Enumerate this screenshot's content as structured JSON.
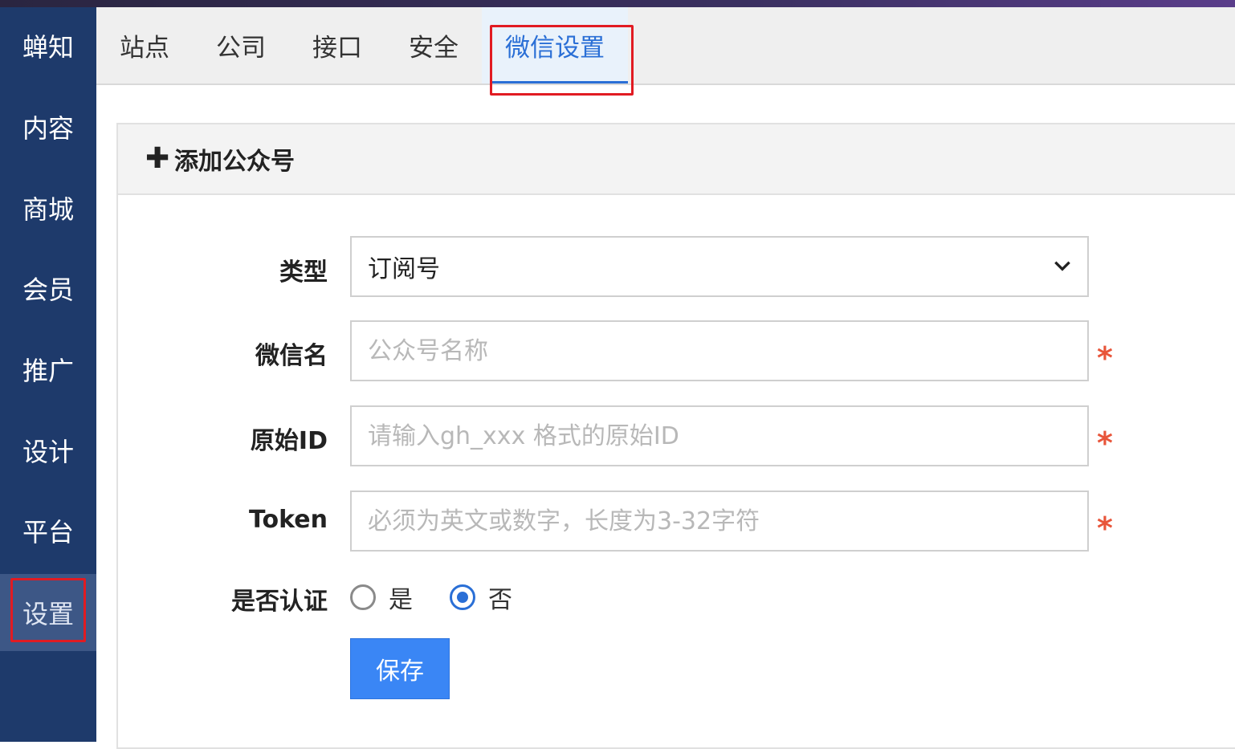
{
  "sidebar": {
    "items": [
      {
        "label": "蝉知"
      },
      {
        "label": "内容"
      },
      {
        "label": "商城"
      },
      {
        "label": "会员"
      },
      {
        "label": "推广"
      },
      {
        "label": "设计"
      },
      {
        "label": "平台"
      },
      {
        "label": "设置"
      }
    ],
    "active": "设置"
  },
  "tabs": [
    {
      "label": "站点"
    },
    {
      "label": "公司"
    },
    {
      "label": "接口"
    },
    {
      "label": "安全"
    },
    {
      "label": "微信设置"
    }
  ],
  "active_tab": "微信设置",
  "panel": {
    "title": "添加公众号"
  },
  "form": {
    "type_label": "类型",
    "type_value": "订阅号",
    "name_label": "微信名",
    "name_placeholder": "公众号名称",
    "original_id_label": "原始ID",
    "original_id_placeholder": "请输入gh_xxx 格式的原始ID",
    "token_label": "Token",
    "token_placeholder": "必须为英文或数字，长度为3-32字符",
    "certified_label": "是否认证",
    "certified_options": [
      "是",
      "否"
    ],
    "certified_selected": "否",
    "required_mark": "*",
    "save_label": "保存"
  },
  "colors": {
    "sidebar_bg": "#1e3a6b",
    "accent": "#2a6fd6",
    "highlight_box": "#e11b22",
    "required": "#e8553a",
    "save_button": "#3a86f5"
  }
}
